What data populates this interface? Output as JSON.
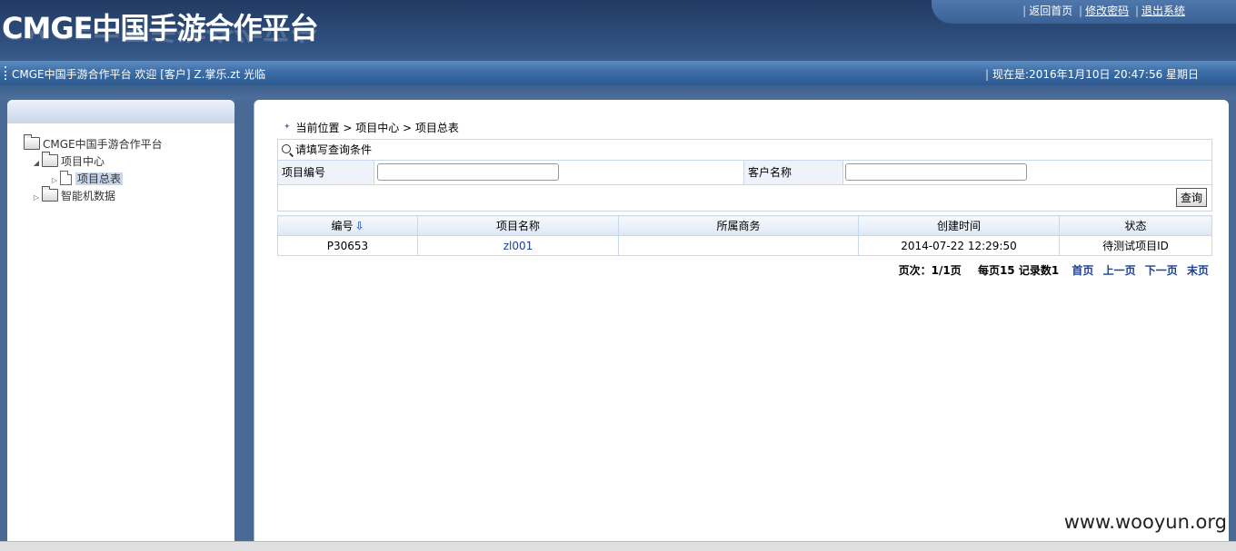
{
  "header": {
    "logo": "CMGE中国手游合作平台",
    "links": [
      "返回首页",
      "修改密码",
      "退出系统"
    ]
  },
  "infobar": {
    "welcome": "CMGE中国手游合作平台 欢迎 [客户] Z.掌乐.zt 光临",
    "clock": "现在是:2016年1月10日 20:47:56 星期日"
  },
  "tree": {
    "root": "CMGE中国手游合作平台",
    "project_center": "项目中心",
    "project_summary": "项目总表",
    "smart_data": "智能机数据"
  },
  "breadcrumb": "当前位置 > 项目中心 > 项目总表",
  "query": {
    "title": "请填写查询条件",
    "project_no_label": "项目编号",
    "project_no_value": "",
    "customer_label": "客户名称",
    "customer_value": "",
    "search_button": "查询"
  },
  "table": {
    "headers": [
      "编号",
      "项目名称",
      "所属商务",
      "创建时间",
      "状态"
    ],
    "rows": [
      [
        "P30653",
        "zl001",
        "",
        "2014-07-22 12:29:50",
        "待测试项目ID"
      ]
    ]
  },
  "pager": {
    "page_info": "页次：1/1页",
    "records_info": "每页15 记录数1",
    "first": "首页",
    "prev": "上一页",
    "next": "下一页",
    "last": "末页"
  },
  "watermark": "www.wooyun.org"
}
